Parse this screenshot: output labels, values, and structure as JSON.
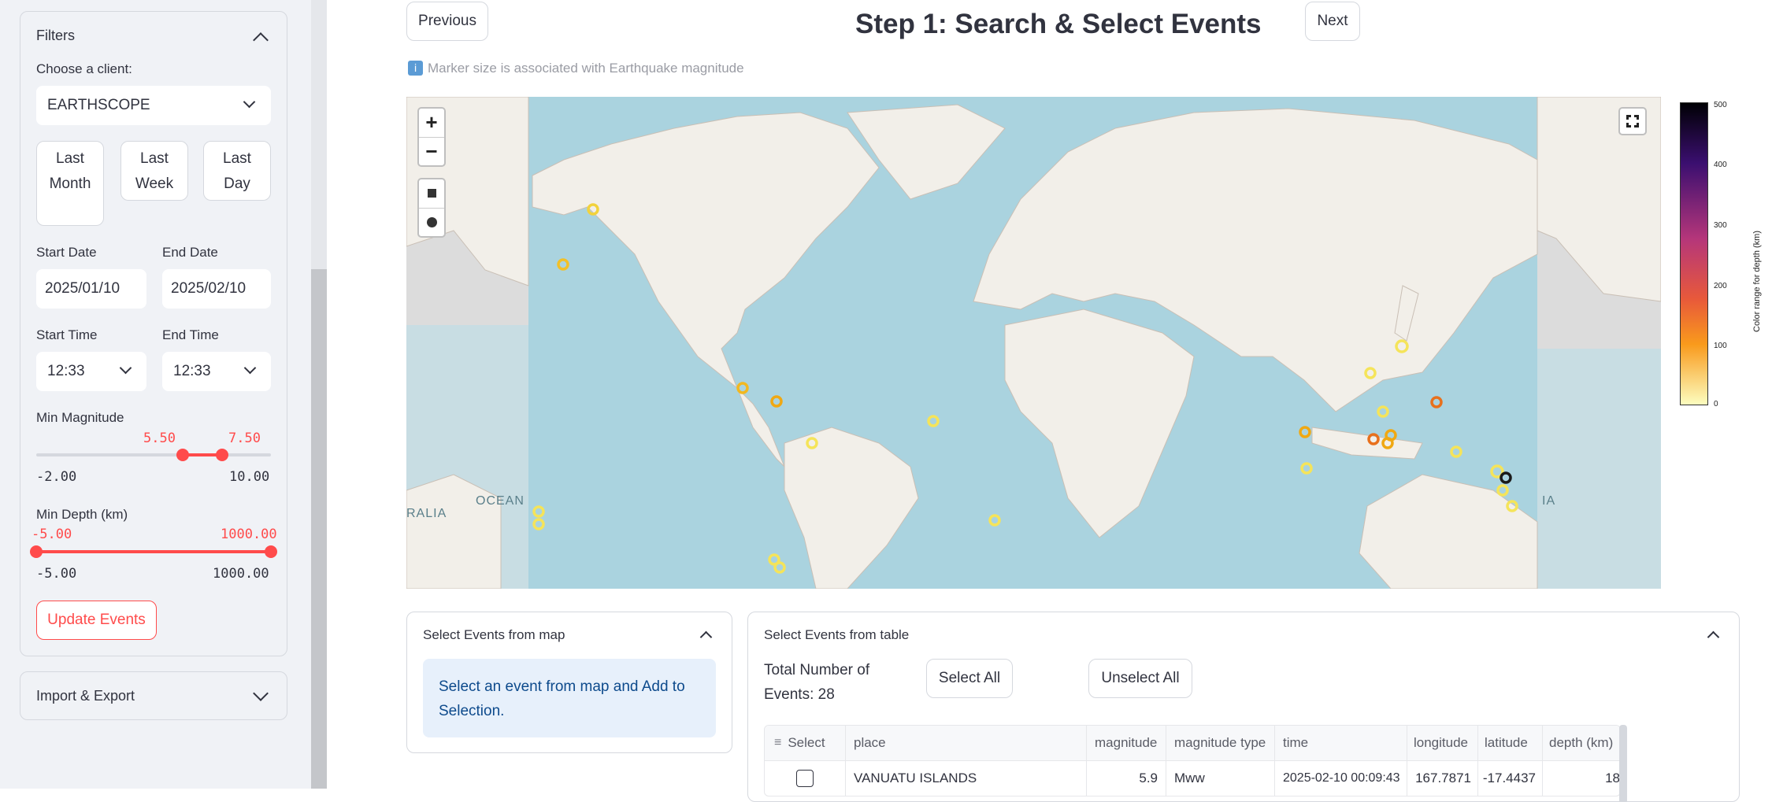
{
  "sidebar": {
    "filters": {
      "title": "Filters",
      "client_label": "Choose a client:",
      "client_value": "EARTHSCOPE",
      "quick": [
        "Last Month",
        "Last Week",
        "Last Day"
      ],
      "start_date_label": "Start Date",
      "start_date": "2025/01/10",
      "end_date_label": "End Date",
      "end_date": "2025/02/10",
      "start_time_label": "Start Time",
      "start_time": "12:33",
      "end_time_label": "End Time",
      "end_time": "12:33",
      "mag_label": "Min Magnitude",
      "mag_low": "5.50",
      "mag_high": "7.50",
      "mag_min": "-2.00",
      "mag_max": "10.00",
      "depth_label": "Min Depth (km)",
      "depth_low": "-5.00",
      "depth_high": "1000.00",
      "depth_min": "-5.00",
      "depth_max": "1000.00",
      "update_label": "Update Events"
    },
    "import_export": {
      "title": "Import & Export"
    }
  },
  "header": {
    "previous": "Previous",
    "title": "Step 1: Search & Select Events",
    "next": "Next",
    "info_icon": "i",
    "info": "Marker size is associated with Earthquake magnitude"
  },
  "map": {
    "zoom_in": "+",
    "zoom_out": "−",
    "labels": {
      "ocean": "OCEAN",
      "ralia": "RALIA",
      "ia": "IA"
    },
    "colorbar": {
      "title": "Color range for depth (km)",
      "ticks": [
        "500",
        "400",
        "300",
        "200",
        "100",
        "0"
      ]
    }
  },
  "map_panel": {
    "title": "Select Events from map",
    "info": "Select an event from map and Add to Selection."
  },
  "table_panel": {
    "title": "Select Events from table",
    "total_label": "Total Number of Events: 28",
    "select_all": "Select All",
    "unselect_all": "Unselect All",
    "columns": [
      "Select",
      "place",
      "magnitude",
      "magnitude type",
      "time",
      "longitude",
      "latitude",
      "depth (km)"
    ],
    "rows": [
      {
        "place": "VANUATU ISLANDS",
        "magnitude": "5.9",
        "magnitude_type": "Mww",
        "time": "2025-02-10 00:09:43",
        "longitude": "167.7871",
        "latitude": "-17.4437",
        "depth": "18"
      }
    ]
  }
}
